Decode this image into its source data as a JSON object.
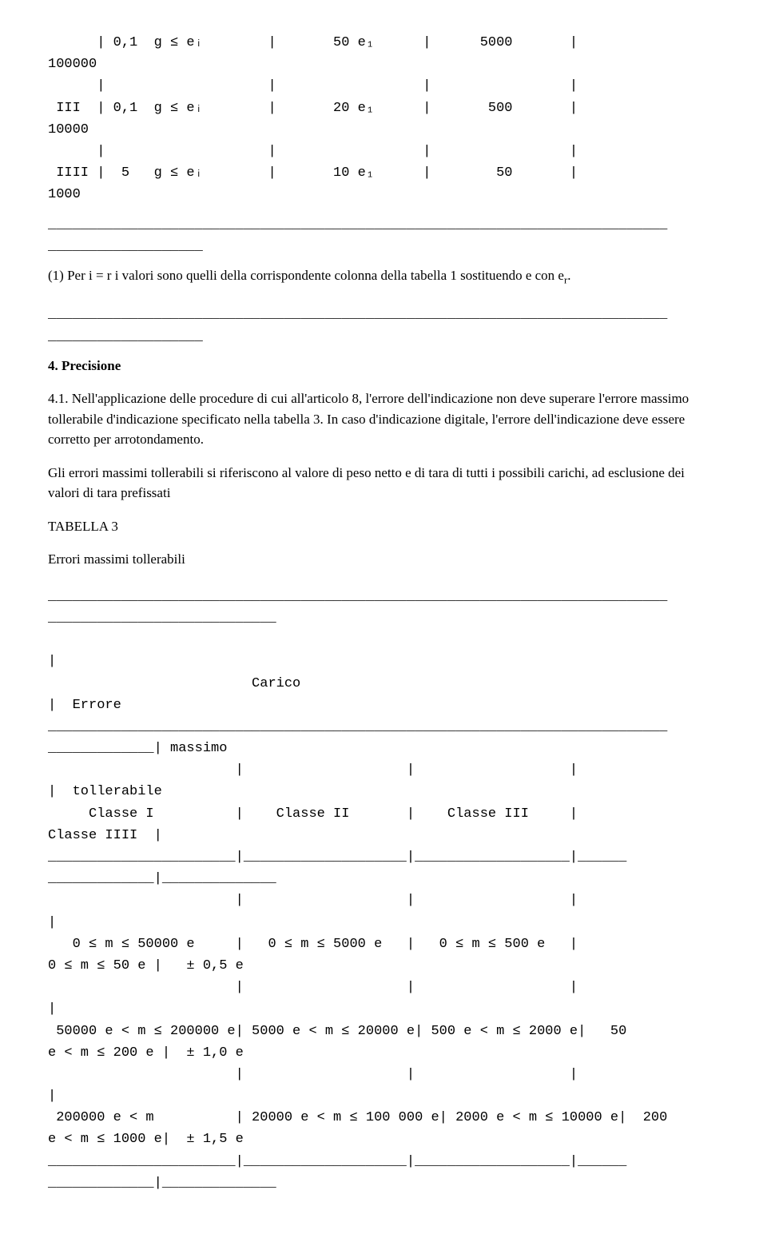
{
  "table_top": {
    "rows": [
      {
        "prefix": "      | 0,1  g ≤ eᵢ        |       50 e₁      |      5000       |",
        "wrap": "100000"
      },
      {
        "prefix": "      |                    |                  |                 |",
        "wrap": ""
      },
      {
        "prefix": " III  | 0,1  g ≤ eᵢ        |       20 e₁      |       500       |",
        "wrap": "10000"
      },
      {
        "prefix": "      |                    |                  |                 |",
        "wrap": ""
      },
      {
        "prefix": " IIII |  5   g ≤ eᵢ        |       10 e₁      |        50       |",
        "wrap": "1000"
      }
    ]
  },
  "footnote1": "(1) Per i = r i valori sono quelli della corrispondente colonna della tabella 1 sostituendo e con e",
  "footnote1_sub": "r",
  "footnote1_tail": ".",
  "sec4_title": "4. Precisione",
  "sec41_num": "4.1.",
  "sec41_body": " Nell'applicazione delle procedure di cui all'articolo 8, l'errore dell'indicazione non deve superare l'errore massimo tollerabile d'indicazione specificato nella tabella 3. In caso d'indicazione digitale, l'errore dell'indicazione deve essere corretto per arrotondamento.",
  "sec41_body2": "Gli errori massimi tollerabili si riferiscono al valore di peso netto e di tara di tutti i possibili carichi, ad esclusione dei valori di tara prefissati",
  "t3_title": "TABELLA 3",
  "t3_caption": "Errori massimi tollerabili",
  "t3": {
    "carico": "Carico",
    "errore": "|  Errore",
    "massimo": "_____________| massimo",
    "header_blank": "                       |                    |                   |",
    "tollerabile_row": "|  tollerabile",
    "classes_row": "     Classe I          |    Classe II       |    Classe III     |",
    "classe_iiii": "Classe IIII  |",
    "rule_segmented": "_______________________|____________________|___________________|______",
    "rule_short": "_____________|______________",
    "blank_pipe4": "                       |                    |                   |",
    "pipe_only": "|",
    "r1_main": "   0 ≤ m ≤ 50000 e     |   0 ≤ m ≤ 5000 e   |   0 ≤ m ≤ 500 e   |",
    "r1_wrap": "0 ≤ m ≤ 50 e |   ± 0,5 e",
    "blank_pipe4b": "                       |                    |                   |",
    "r2_main": " 50000 e < m ≤ 200000 e| 5000 e < m ≤ 20000 e| 500 e < m ≤ 2000 e|   50",
    "r2_wrap": "e < m ≤ 200 e |  ± 1,0 e",
    "blank_pipe4c": "                       |                    |                   |",
    "r3_main": " 200000 e < m          | 20000 e < m ≤ 100 000 e| 2000 e < m ≤ 10000 e|  200",
    "r3_wrap": "e < m ≤ 1000 e|  ± 1,5 e",
    "rule_bottom": "_______________________|____________________|___________________|______",
    "rule_bottom_wrap": "_____________|______________"
  }
}
